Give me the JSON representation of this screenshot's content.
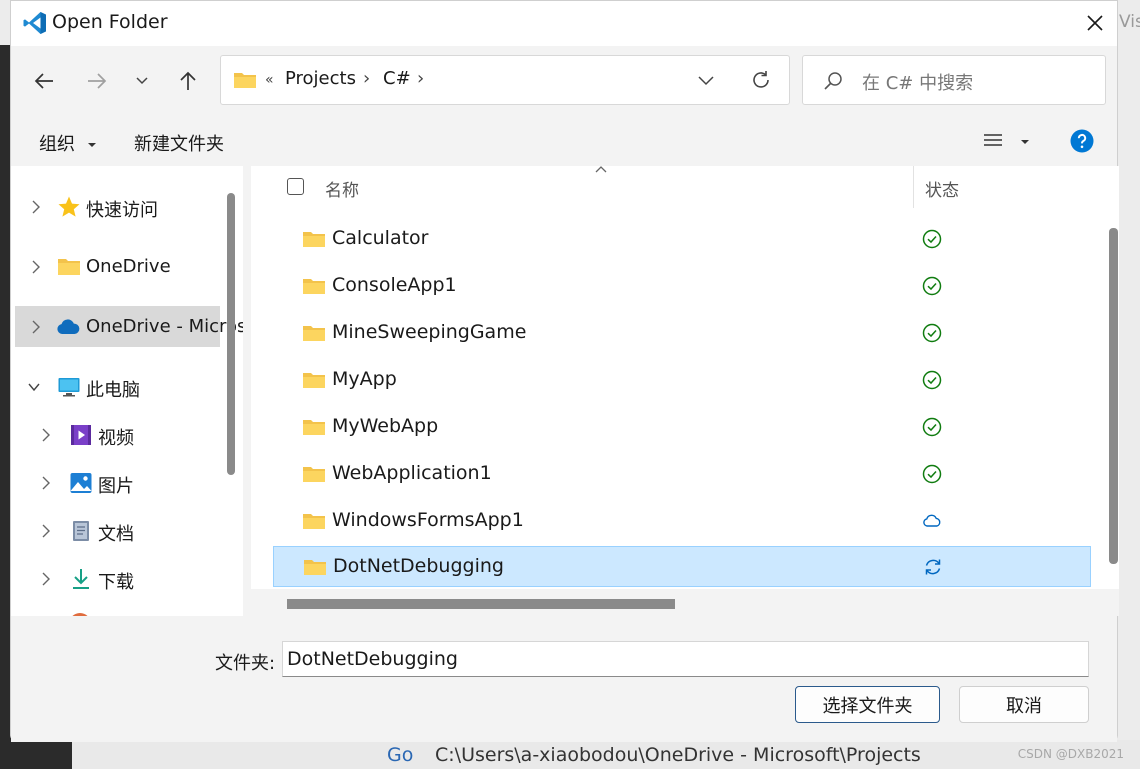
{
  "window": {
    "title": "Open Folder",
    "close_icon": "close-icon"
  },
  "nav": {
    "back_icon": "arrow-left-icon",
    "forward_icon": "arrow-right-icon",
    "recent_icon": "chevron-down-icon",
    "up_icon": "arrow-up-icon"
  },
  "address": {
    "overflow": "«",
    "crumbs": [
      "Projects",
      "C#"
    ],
    "sep": "›",
    "dropdown_icon": "chevron-down-icon",
    "refresh_icon": "refresh-icon"
  },
  "search": {
    "placeholder": "在 C# 中搜索",
    "icon": "search-icon"
  },
  "commands": {
    "organize": "组织",
    "new_folder": "新建文件夹",
    "view_icon": "list-view-icon",
    "help_icon": "help-icon"
  },
  "sidebar": {
    "items": [
      {
        "label": "快速访问",
        "icon": "star-icon"
      },
      {
        "label": "OneDrive",
        "icon": "folder-icon"
      },
      {
        "label": "OneDrive - Microsoft",
        "icon": "cloud-icon"
      },
      {
        "label": "此电脑",
        "icon": "computer-icon"
      },
      {
        "label": "视频",
        "icon": "video-icon"
      },
      {
        "label": "图片",
        "icon": "picture-icon"
      },
      {
        "label": "文档",
        "icon": "document-icon"
      },
      {
        "label": "下载",
        "icon": "download-icon"
      }
    ]
  },
  "columns": {
    "name": "名称",
    "status": "状态"
  },
  "files": [
    {
      "name": "Calculator",
      "status": "synced"
    },
    {
      "name": "ConsoleApp1",
      "status": "synced"
    },
    {
      "name": "MineSweepingGame",
      "status": "synced"
    },
    {
      "name": "MyApp",
      "status": "synced"
    },
    {
      "name": "MyWebApp",
      "status": "synced"
    },
    {
      "name": "WebApplication1",
      "status": "synced"
    },
    {
      "name": "WindowsFormsApp1",
      "status": "cloud"
    },
    {
      "name": "DotNetDebugging",
      "status": "syncing",
      "selected": true
    }
  ],
  "footer": {
    "folder_label": "文件夹:",
    "folder_value": "DotNetDebugging",
    "select_button": "选择文件夹",
    "cancel_button": "取消"
  },
  "background": {
    "go": "Go",
    "path": "C:\\Users\\a-xiaobodou\\OneDrive - Microsoft\\Projects",
    "right_text": "Visu",
    "watermark": "CSDN @DXB2021"
  },
  "colors": {
    "selection": "#cce8ff",
    "accent": "#0067c0",
    "status_green": "#107c10",
    "status_blue": "#0067c0"
  }
}
